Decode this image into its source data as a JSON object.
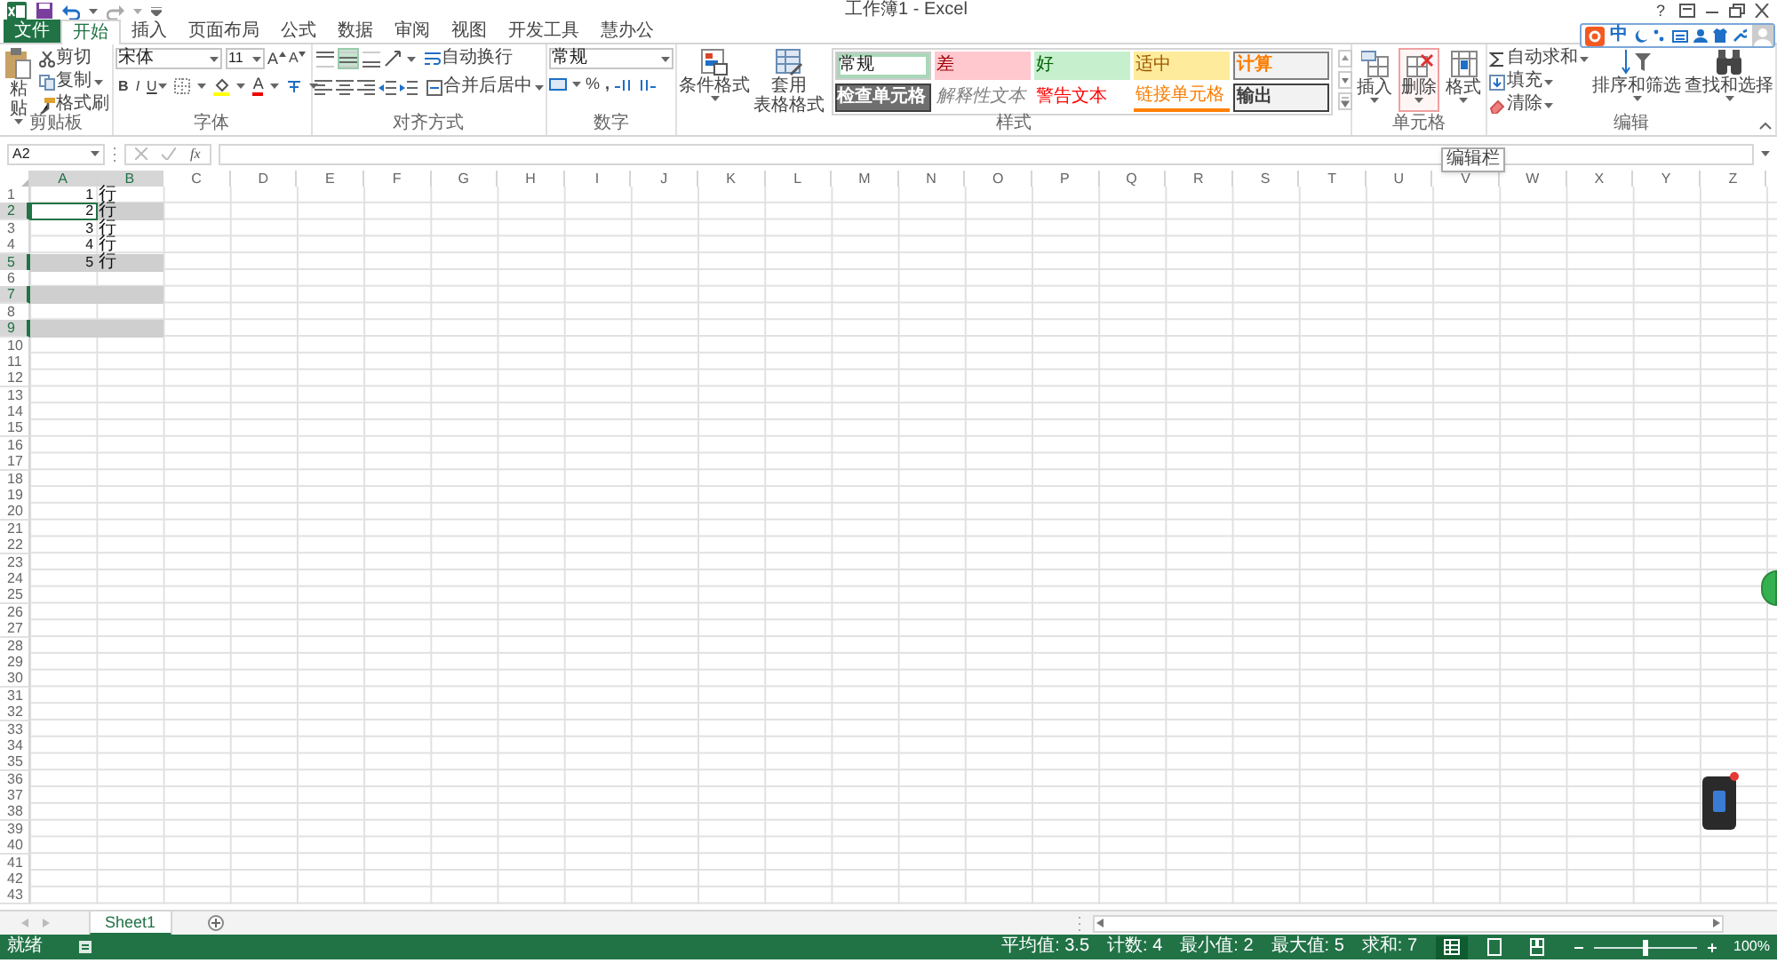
{
  "window": {
    "title": "工作簿1 - Excel",
    "help": "?"
  },
  "ime_toolbar": {
    "mode": "中"
  },
  "tabs": [
    {
      "label": "文件",
      "kind": "file",
      "selected": false
    },
    {
      "label": "开始",
      "kind": "tab",
      "selected": true
    },
    {
      "label": "插入",
      "kind": "tab",
      "selected": false
    },
    {
      "label": "页面布局",
      "kind": "tab",
      "selected": false
    },
    {
      "label": "公式",
      "kind": "tab",
      "selected": false
    },
    {
      "label": "数据",
      "kind": "tab",
      "selected": false
    },
    {
      "label": "审阅",
      "kind": "tab",
      "selected": false
    },
    {
      "label": "视图",
      "kind": "tab",
      "selected": false
    },
    {
      "label": "开发工具",
      "kind": "tab",
      "selected": false
    },
    {
      "label": "慧办公",
      "kind": "tab",
      "selected": false
    }
  ],
  "ribbon": {
    "clipboard": {
      "label": "剪贴板",
      "paste": "粘贴",
      "cut": "剪切",
      "copy": "复制",
      "format_painter": "格式刷"
    },
    "font": {
      "label": "字体",
      "font_name": "宋体",
      "font_size": "11",
      "grow": "A",
      "shrink": "A",
      "bold": "B",
      "italic": "I",
      "underline": "U",
      "font_color": "A"
    },
    "alignment": {
      "label": "对齐方式",
      "vertical_align": [
        {
          "kind": "top",
          "selected": false
        },
        {
          "kind": "middle",
          "selected": true
        },
        {
          "kind": "bottom",
          "selected": false
        }
      ],
      "wrap_text": "自动换行",
      "merge_center": "合并后居中"
    },
    "number": {
      "label": "数字",
      "format": "常规",
      "percent": "%",
      "comma": ","
    },
    "styles": {
      "label": "样式",
      "conditional_formatting": "条件格式",
      "format_as_table": [
        "套用",
        "表格格式"
      ],
      "cell_styles": [
        {
          "label": "常规",
          "kind": "normal",
          "selected": true
        },
        {
          "label": "差",
          "kind": "bad",
          "selected": false
        },
        {
          "label": "好",
          "kind": "good",
          "selected": false
        },
        {
          "label": "适中",
          "kind": "neutral",
          "selected": false
        },
        {
          "label": "计算",
          "kind": "calculation",
          "selected": false
        },
        {
          "label": "检查单元格",
          "kind": "check",
          "selected": false
        },
        {
          "label": "解释性文本",
          "kind": "explanatory",
          "selected": false
        },
        {
          "label": "警告文本",
          "kind": "warning",
          "selected": false
        },
        {
          "label": "链接单元格",
          "kind": "linked",
          "selected": false
        },
        {
          "label": "输出",
          "kind": "output",
          "selected": false
        }
      ]
    },
    "cells": {
      "label": "单元格",
      "buttons": [
        {
          "label": "插入",
          "kind": "insert",
          "highlighted": false
        },
        {
          "label": "删除",
          "kind": "delete",
          "highlighted": true
        },
        {
          "label": "格式",
          "kind": "format",
          "highlighted": false
        }
      ]
    },
    "editing": {
      "label": "编辑",
      "autosum": "自动求和",
      "fill": "填充",
      "clear": "清除",
      "sort_filter": "排序和筛选",
      "find_select": "查找和选择"
    }
  },
  "formula_bar": {
    "name_box": "A2",
    "function_label": "fx"
  },
  "tooltip": "编辑栏",
  "columns": [
    {
      "label": "A",
      "selected": true
    },
    {
      "label": "B",
      "selected": true
    },
    {
      "label": "C",
      "selected": false
    },
    {
      "label": "D",
      "selected": false
    },
    {
      "label": "E",
      "selected": false
    },
    {
      "label": "F",
      "selected": false
    },
    {
      "label": "G",
      "selected": false
    },
    {
      "label": "H",
      "selected": false
    },
    {
      "label": "I",
      "selected": false
    },
    {
      "label": "J",
      "selected": false
    },
    {
      "label": "K",
      "selected": false
    },
    {
      "label": "L",
      "selected": false
    },
    {
      "label": "M",
      "selected": false
    },
    {
      "label": "N",
      "selected": false
    },
    {
      "label": "O",
      "selected": false
    },
    {
      "label": "P",
      "selected": false
    },
    {
      "label": "Q",
      "selected": false
    },
    {
      "label": "R",
      "selected": false
    },
    {
      "label": "S",
      "selected": false
    },
    {
      "label": "T",
      "selected": false
    },
    {
      "label": "U",
      "selected": false
    },
    {
      "label": "V",
      "selected": false
    },
    {
      "label": "W",
      "selected": false
    },
    {
      "label": "X",
      "selected": false
    },
    {
      "label": "Y",
      "selected": false
    },
    {
      "label": "Z",
      "selected": false
    }
  ],
  "rows": [
    {
      "label": "1",
      "selected": false,
      "cells": [
        {
          "text": "1",
          "kind": "number",
          "active": false
        },
        {
          "text": "行",
          "kind": "text",
          "active": false
        }
      ]
    },
    {
      "label": "2",
      "selected": true,
      "cells": [
        {
          "text": "2",
          "kind": "number",
          "active": true
        },
        {
          "text": "行",
          "kind": "text",
          "active": false
        }
      ]
    },
    {
      "label": "3",
      "selected": false,
      "cells": [
        {
          "text": "3",
          "kind": "number",
          "active": false
        },
        {
          "text": "行",
          "kind": "text",
          "active": false
        }
      ]
    },
    {
      "label": "4",
      "selected": false,
      "cells": [
        {
          "text": "4",
          "kind": "number",
          "active": false
        },
        {
          "text": "行",
          "kind": "text",
          "active": false
        }
      ]
    },
    {
      "label": "5",
      "selected": true,
      "cells": [
        {
          "text": "5",
          "kind": "number",
          "active": false
        },
        {
          "text": "行",
          "kind": "text",
          "active": false
        }
      ]
    },
    {
      "label": "6",
      "selected": false
    },
    {
      "label": "7",
      "selected": true
    },
    {
      "label": "8",
      "selected": false
    },
    {
      "label": "9",
      "selected": true
    },
    {
      "label": "10",
      "selected": false
    },
    {
      "label": "11",
      "selected": false
    },
    {
      "label": "12",
      "selected": false
    },
    {
      "label": "13",
      "selected": false
    },
    {
      "label": "14",
      "selected": false
    },
    {
      "label": "15",
      "selected": false
    },
    {
      "label": "16",
      "selected": false
    },
    {
      "label": "17",
      "selected": false
    },
    {
      "label": "18",
      "selected": false
    },
    {
      "label": "19",
      "selected": false
    },
    {
      "label": "20",
      "selected": false
    },
    {
      "label": "21",
      "selected": false
    },
    {
      "label": "22",
      "selected": false
    },
    {
      "label": "23",
      "selected": false
    },
    {
      "label": "24",
      "selected": false
    },
    {
      "label": "25",
      "selected": false
    },
    {
      "label": "26",
      "selected": false
    },
    {
      "label": "27",
      "selected": false
    },
    {
      "label": "28",
      "selected": false
    },
    {
      "label": "29",
      "selected": false
    },
    {
      "label": "30",
      "selected": false
    },
    {
      "label": "31",
      "selected": false
    },
    {
      "label": "32",
      "selected": false
    },
    {
      "label": "33",
      "selected": false
    },
    {
      "label": "34",
      "selected": false
    },
    {
      "label": "35",
      "selected": false
    },
    {
      "label": "36",
      "selected": false
    },
    {
      "label": "37",
      "selected": false
    },
    {
      "label": "38",
      "selected": false
    },
    {
      "label": "39",
      "selected": false
    },
    {
      "label": "40",
      "selected": false
    },
    {
      "label": "41",
      "selected": false
    },
    {
      "label": "42",
      "selected": false
    },
    {
      "label": "43",
      "selected": false
    }
  ],
  "sheets": [
    {
      "label": "Sheet1",
      "selected": true
    }
  ],
  "status_bar": {
    "mode": "就绪",
    "stats": [
      "平均值: 3.5",
      "计数: 4",
      "最小值: 2",
      "最大值: 5",
      "求和: 7"
    ],
    "views": [
      {
        "kind": "normal",
        "selected": true
      },
      {
        "kind": "page_layout",
        "selected": false
      },
      {
        "kind": "page_break",
        "selected": false
      }
    ],
    "zoom": {
      "level": 0.5,
      "label": "100%"
    }
  }
}
